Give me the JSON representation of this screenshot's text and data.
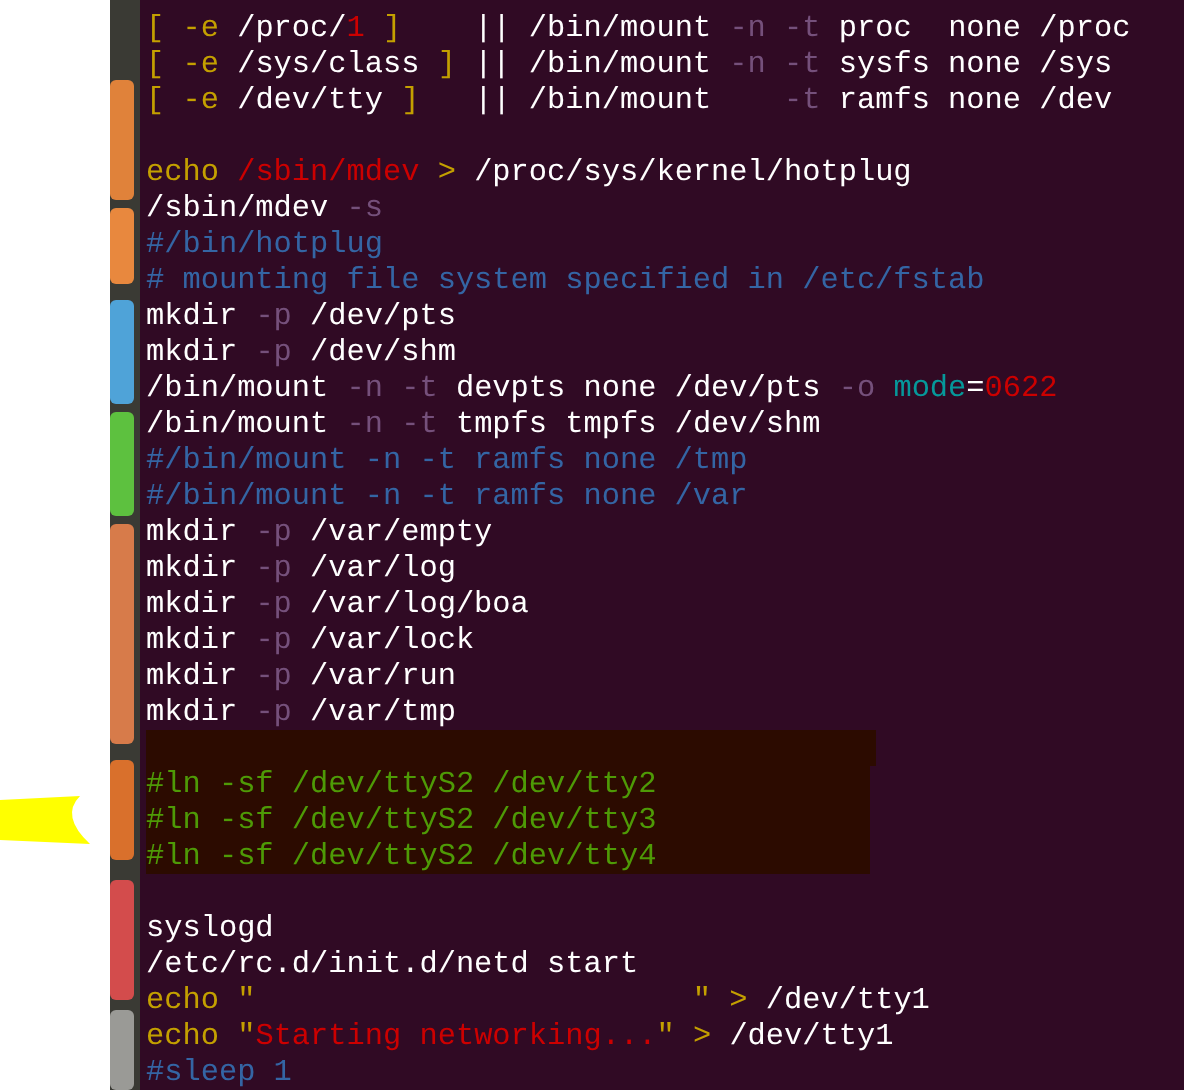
{
  "lines": [
    {
      "kind": "code",
      "segments": [
        {
          "text": "[ -e ",
          "kind": "keyword"
        },
        {
          "text": "/proc/",
          "kind": "plain"
        },
        {
          "text": "1",
          "kind": "string"
        },
        {
          "text": " ]",
          "kind": "keyword"
        },
        {
          "text": "    || /bin/mount ",
          "kind": "plain"
        },
        {
          "text": "-n -t",
          "kind": "option"
        },
        {
          "text": " proc  none /proc",
          "kind": "plain"
        }
      ]
    },
    {
      "kind": "code",
      "segments": [
        {
          "text": "[ -e ",
          "kind": "keyword"
        },
        {
          "text": "/sys/class",
          "kind": "plain"
        },
        {
          "text": " ]",
          "kind": "keyword"
        },
        {
          "text": " || /bin/mount ",
          "kind": "plain"
        },
        {
          "text": "-n -t",
          "kind": "option"
        },
        {
          "text": " sysfs none /sys",
          "kind": "plain"
        }
      ]
    },
    {
      "kind": "code",
      "segments": [
        {
          "text": "[ -e ",
          "kind": "keyword"
        },
        {
          "text": "/dev/tty",
          "kind": "plain"
        },
        {
          "text": " ]",
          "kind": "keyword"
        },
        {
          "text": "   || /bin/mount    ",
          "kind": "plain"
        },
        {
          "text": "-t",
          "kind": "option"
        },
        {
          "text": " ramfs none /dev",
          "kind": "plain"
        }
      ]
    },
    {
      "kind": "blank"
    },
    {
      "kind": "code",
      "segments": [
        {
          "text": "echo ",
          "kind": "keyword"
        },
        {
          "text": "/sbin/mdev",
          "kind": "string"
        },
        {
          "text": " > ",
          "kind": "keyword"
        },
        {
          "text": "/proc/sys/kernel/hotplug",
          "kind": "plain"
        }
      ]
    },
    {
      "kind": "code",
      "segments": [
        {
          "text": "/sbin/mdev ",
          "kind": "plain"
        },
        {
          "text": "-s",
          "kind": "option"
        }
      ]
    },
    {
      "kind": "code",
      "segments": [
        {
          "text": "#/bin/hotplug",
          "kind": "comment"
        }
      ]
    },
    {
      "kind": "code",
      "segments": [
        {
          "text": "# mounting file system specified in /etc/fstab",
          "kind": "comment"
        }
      ]
    },
    {
      "kind": "code",
      "segments": [
        {
          "text": "mkdir ",
          "kind": "plain"
        },
        {
          "text": "-p",
          "kind": "option"
        },
        {
          "text": " /dev/pts",
          "kind": "plain"
        }
      ]
    },
    {
      "kind": "code",
      "segments": [
        {
          "text": "mkdir ",
          "kind": "plain"
        },
        {
          "text": "-p",
          "kind": "option"
        },
        {
          "text": " /dev/shm",
          "kind": "plain"
        }
      ]
    },
    {
      "kind": "code",
      "segments": [
        {
          "text": "/bin/mount ",
          "kind": "plain"
        },
        {
          "text": "-n -t",
          "kind": "option"
        },
        {
          "text": " devpts none /dev/pts ",
          "kind": "plain"
        },
        {
          "text": "-o ",
          "kind": "option"
        },
        {
          "text": "mode",
          "kind": "attribute"
        },
        {
          "text": "=",
          "kind": "plain"
        },
        {
          "text": "0622",
          "kind": "string"
        }
      ]
    },
    {
      "kind": "code",
      "segments": [
        {
          "text": "/bin/mount ",
          "kind": "plain"
        },
        {
          "text": "-n -t",
          "kind": "option"
        },
        {
          "text": " tmpfs tmpfs /dev/shm",
          "kind": "plain"
        }
      ]
    },
    {
      "kind": "code",
      "segments": [
        {
          "text": "#/bin/mount -n -t ramfs none /tmp",
          "kind": "comment"
        }
      ]
    },
    {
      "kind": "code",
      "segments": [
        {
          "text": "#/bin/mount -n -t ramfs none /var",
          "kind": "comment"
        }
      ]
    },
    {
      "kind": "code",
      "segments": [
        {
          "text": "mkdir ",
          "kind": "plain"
        },
        {
          "text": "-p",
          "kind": "option"
        },
        {
          "text": " /var/empty",
          "kind": "plain"
        }
      ]
    },
    {
      "kind": "code",
      "segments": [
        {
          "text": "mkdir ",
          "kind": "plain"
        },
        {
          "text": "-p",
          "kind": "option"
        },
        {
          "text": " /var/log",
          "kind": "plain"
        }
      ]
    },
    {
      "kind": "code",
      "segments": [
        {
          "text": "mkdir ",
          "kind": "plain"
        },
        {
          "text": "-p",
          "kind": "option"
        },
        {
          "text": " /var/log/boa",
          "kind": "plain"
        }
      ]
    },
    {
      "kind": "code",
      "segments": [
        {
          "text": "mkdir ",
          "kind": "plain"
        },
        {
          "text": "-p",
          "kind": "option"
        },
        {
          "text": " /var/lock",
          "kind": "plain"
        }
      ]
    },
    {
      "kind": "code",
      "segments": [
        {
          "text": "mkdir ",
          "kind": "plain"
        },
        {
          "text": "-p",
          "kind": "option"
        },
        {
          "text": " /var/run",
          "kind": "plain"
        }
      ]
    },
    {
      "kind": "code",
      "segments": [
        {
          "text": "mkdir ",
          "kind": "plain"
        },
        {
          "text": "-p",
          "kind": "option"
        },
        {
          "text": " /var/tmp",
          "kind": "plain"
        }
      ]
    },
    {
      "kind": "blank",
      "highlighted": true
    },
    {
      "kind": "code",
      "highlighted": true,
      "segments": [
        {
          "text": "#ln -sf /dev/ttyS2 /dev/tty2",
          "kind": "inactive"
        }
      ]
    },
    {
      "kind": "code",
      "highlighted": true,
      "segments": [
        {
          "text": "#ln -sf /dev/ttyS2 /dev/tty3",
          "kind": "inactive"
        }
      ]
    },
    {
      "kind": "code",
      "highlighted": true,
      "segments": [
        {
          "text": "#ln -sf /dev/ttyS2 /dev/tty4",
          "kind": "inactive"
        }
      ]
    },
    {
      "kind": "blank"
    },
    {
      "kind": "code",
      "segments": [
        {
          "text": "syslogd",
          "kind": "plain"
        }
      ]
    },
    {
      "kind": "code",
      "segments": [
        {
          "text": "/etc/rc.d/init.d/netd start",
          "kind": "plain"
        }
      ]
    },
    {
      "kind": "code",
      "segments": [
        {
          "text": "echo ",
          "kind": "keyword"
        },
        {
          "text": "\"                        \"",
          "kind": "keyword"
        },
        {
          "text": " > ",
          "kind": "keyword"
        },
        {
          "text": "/dev/tty1",
          "kind": "plain"
        }
      ]
    },
    {
      "kind": "code",
      "segments": [
        {
          "text": "echo ",
          "kind": "keyword"
        },
        {
          "text": "\"",
          "kind": "keyword"
        },
        {
          "text": "Starting networking...",
          "kind": "string"
        },
        {
          "text": "\"",
          "kind": "keyword"
        },
        {
          "text": " > ",
          "kind": "keyword"
        },
        {
          "text": "/dev/tty1",
          "kind": "plain"
        }
      ]
    },
    {
      "kind": "code",
      "segments": [
        {
          "text": "#sleep 1",
          "kind": "comment"
        }
      ]
    }
  ]
}
